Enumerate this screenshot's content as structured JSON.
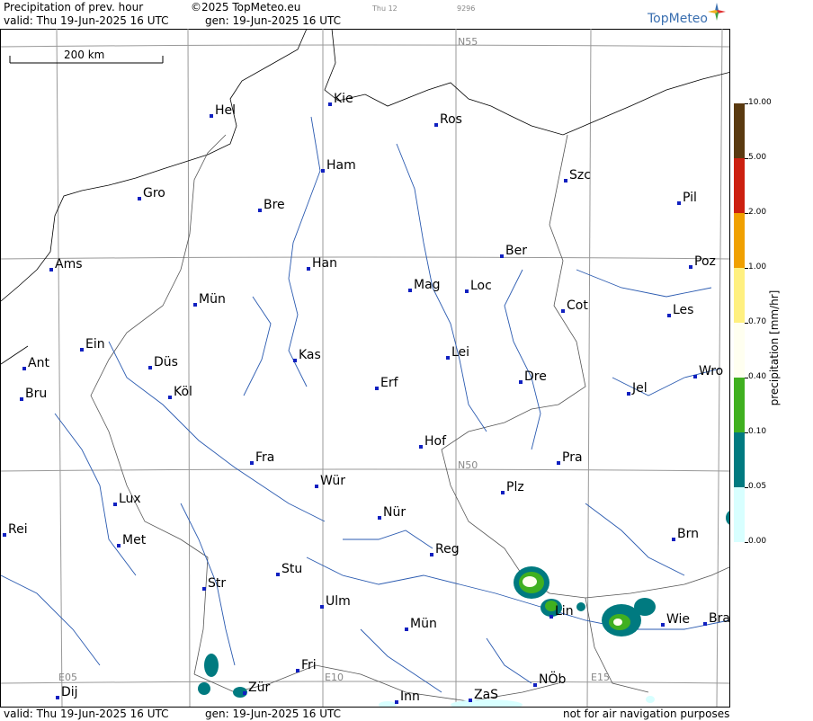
{
  "header": {
    "title": "Precipitation of prev. hour",
    "copyright": "©2025 TopMeteo.eu",
    "run_day": "Thu 12",
    "code": "9296",
    "valid": "valid:  Thu  19-Jun-2025  16 UTC",
    "gen": "gen: 19-Jun-2025 16 UTC",
    "logo": "TopMeteo"
  },
  "footer": {
    "valid": "valid:  Thu  19-Jun-2025  16 UTC",
    "gen": "gen: 19-Jun-2025 16 UTC",
    "note": "not for air navigation purposes"
  },
  "map": {
    "scale_label": "200 km",
    "grid_labels": [
      "N55",
      "N50",
      "E05",
      "E10",
      "E15"
    ],
    "cities": [
      {
        "name": "Kie"
      },
      {
        "name": "Hel"
      },
      {
        "name": "Ros"
      },
      {
        "name": "Ham"
      },
      {
        "name": "Szc"
      },
      {
        "name": "Gro"
      },
      {
        "name": "Bre"
      },
      {
        "name": "Pil"
      },
      {
        "name": "Ber"
      },
      {
        "name": "Ams"
      },
      {
        "name": "Han"
      },
      {
        "name": "Poz"
      },
      {
        "name": "Mag"
      },
      {
        "name": "Loc"
      },
      {
        "name": "Mün"
      },
      {
        "name": "Cot"
      },
      {
        "name": "Les"
      },
      {
        "name": "Ein"
      },
      {
        "name": "Kas"
      },
      {
        "name": "Lei"
      },
      {
        "name": "Ant"
      },
      {
        "name": "Düs"
      },
      {
        "name": "Wro"
      },
      {
        "name": "Erf"
      },
      {
        "name": "Dre"
      },
      {
        "name": "Bru"
      },
      {
        "name": "Köl"
      },
      {
        "name": "Jel"
      },
      {
        "name": "Hof"
      },
      {
        "name": "Fra"
      },
      {
        "name": "Pra"
      },
      {
        "name": "Wür"
      },
      {
        "name": "Plz"
      },
      {
        "name": "Lux"
      },
      {
        "name": "Nür"
      },
      {
        "name": "Rei"
      },
      {
        "name": "Met"
      },
      {
        "name": "Brn"
      },
      {
        "name": "Reg"
      },
      {
        "name": "Stu"
      },
      {
        "name": "Str"
      },
      {
        "name": "Ulm"
      },
      {
        "name": "Lin"
      },
      {
        "name": "Wie"
      },
      {
        "name": "Bra"
      },
      {
        "name": "Mün"
      },
      {
        "name": "Fri"
      },
      {
        "name": "NÖb"
      },
      {
        "name": "Dij"
      },
      {
        "name": "Zür"
      },
      {
        "name": "Inn"
      },
      {
        "name": "ZaS"
      }
    ]
  },
  "legend": {
    "title": "precipitation  [mm/hr]",
    "levels": [
      "10.00",
      "5.00",
      "2.00",
      "1.00",
      "0.70",
      "0.40",
      "0.10",
      "0.05",
      "0.00"
    ],
    "colors": [
      "#5a3a10",
      "#cc2010",
      "#f0a000",
      "#fff080",
      "#fffff0",
      "#40b020",
      "#007a80",
      "#d8ffff",
      "#ffffff"
    ]
  }
}
